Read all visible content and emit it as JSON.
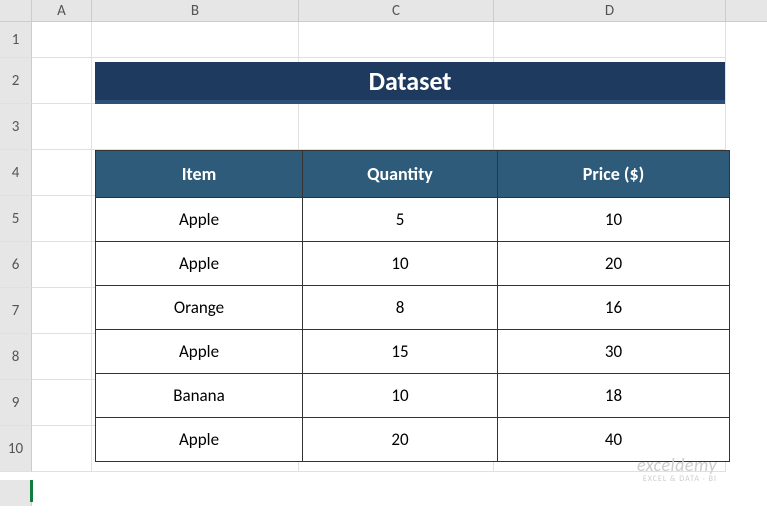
{
  "columns": [
    "A",
    "B",
    "C",
    "D"
  ],
  "rows": [
    "1",
    "2",
    "3",
    "4",
    "5",
    "6",
    "7",
    "8",
    "9",
    "10"
  ],
  "title": "Dataset",
  "table": {
    "headers": [
      "Item",
      "Quantity",
      "Price ($)"
    ],
    "data": [
      [
        "Apple",
        "5",
        "10"
      ],
      [
        "Apple",
        "10",
        "20"
      ],
      [
        "Orange",
        "8",
        "16"
      ],
      [
        "Apple",
        "15",
        "30"
      ],
      [
        "Banana",
        "10",
        "18"
      ],
      [
        "Apple",
        "20",
        "40"
      ]
    ]
  },
  "watermark": {
    "main": "exceldemy",
    "sub": "EXCEL & DATA · BI"
  },
  "chart_data": {
    "type": "table",
    "title": "Dataset",
    "columns": [
      "Item",
      "Quantity",
      "Price ($)"
    ],
    "rows": [
      {
        "Item": "Apple",
        "Quantity": 5,
        "Price ($)": 10
      },
      {
        "Item": "Apple",
        "Quantity": 10,
        "Price ($)": 20
      },
      {
        "Item": "Orange",
        "Quantity": 8,
        "Price ($)": 16
      },
      {
        "Item": "Apple",
        "Quantity": 15,
        "Price ($)": 30
      },
      {
        "Item": "Banana",
        "Quantity": 10,
        "Price ($)": 18
      },
      {
        "Item": "Apple",
        "Quantity": 20,
        "Price ($)": 40
      }
    ]
  }
}
